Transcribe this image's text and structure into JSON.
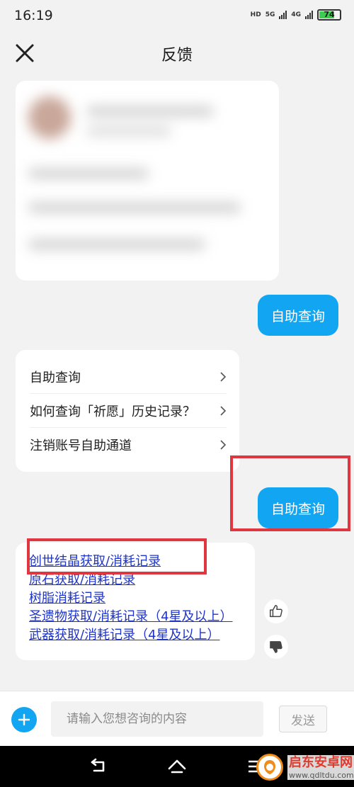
{
  "status_bar": {
    "time": "16:19",
    "hd_label": "HD",
    "net1": "5G",
    "net2": "4G",
    "battery": "74"
  },
  "header": {
    "title": "反馈",
    "close_icon": "close-icon"
  },
  "messages": {
    "user_bubble_1": "自助查询",
    "menu": [
      "自助查询",
      "如何查询「祈愿」历史记录？",
      "注销账号自助通道"
    ],
    "user_bubble_2": "自助查询",
    "links": [
      "创世结晶获取/消耗记录",
      "原石获取/消耗记录",
      "树脂消耗记录",
      "圣遗物获取/消耗记录（4星及以上）",
      "武器获取/消耗记录（4星及以上）"
    ]
  },
  "input_bar": {
    "placeholder": "请输入您想咨询的内容",
    "send_label": "发送"
  },
  "watermark": {
    "name": "启东安卓网",
    "url": "www.qdltdu.com"
  },
  "colors": {
    "accent": "#12a6f2",
    "link": "#1f34c9",
    "highlight": "#e0363f"
  }
}
